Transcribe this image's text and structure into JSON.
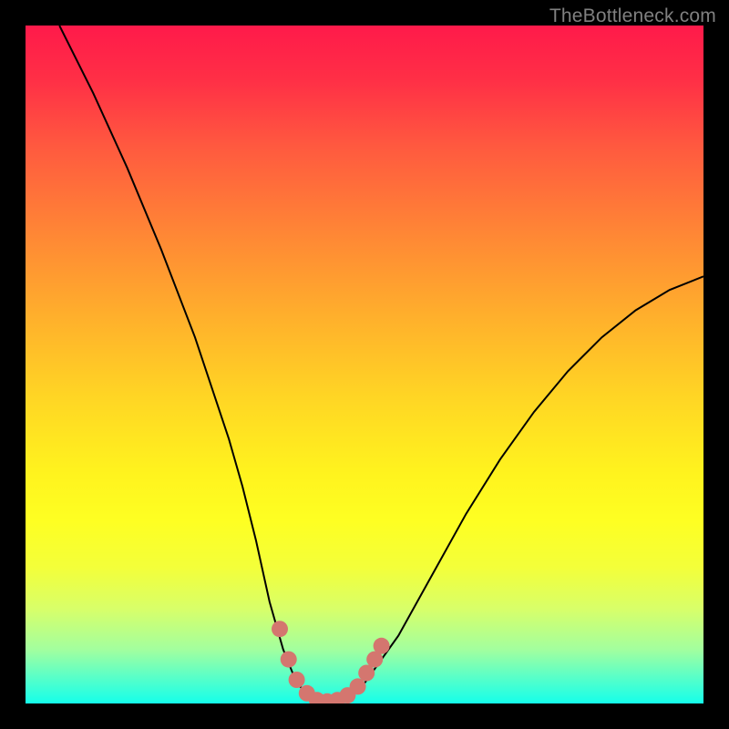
{
  "watermark": "TheBottleneck.com",
  "chart_data": {
    "type": "line",
    "title": "",
    "xlabel": "",
    "ylabel": "",
    "xlim": [
      0,
      100
    ],
    "ylim": [
      0,
      100
    ],
    "series": [
      {
        "name": "bottleneck-curve",
        "x": [
          5,
          10,
          15,
          20,
          25,
          30,
          32,
          34,
          36,
          38,
          40,
          42,
          44,
          46,
          48,
          50,
          55,
          60,
          65,
          70,
          75,
          80,
          85,
          90,
          95,
          100
        ],
        "y": [
          100,
          90,
          79,
          67,
          54,
          39,
          32,
          24,
          15,
          8,
          3,
          1,
          0,
          0,
          1,
          3,
          10,
          19,
          28,
          36,
          43,
          49,
          54,
          58,
          61,
          63
        ]
      }
    ],
    "marker_points": {
      "name": "highlight-dots",
      "x": [
        37.5,
        38.8,
        40.0,
        41.5,
        43.0,
        44.5,
        46.0,
        47.5,
        49.0,
        50.3,
        51.5,
        52.5
      ],
      "y": [
        11.0,
        6.5,
        3.5,
        1.5,
        0.5,
        0.3,
        0.5,
        1.2,
        2.5,
        4.5,
        6.5,
        8.5
      ]
    },
    "colors": {
      "curve": "#000000",
      "markers": "#d4766f",
      "gradient_top": "#ff1a4a",
      "gradient_bottom": "#15ffea"
    }
  }
}
